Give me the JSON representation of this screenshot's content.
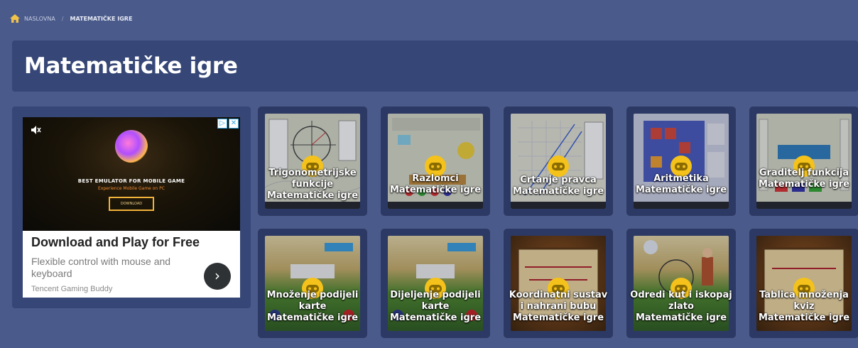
{
  "breadcrumb": {
    "home_icon": "home-icon",
    "home_label": "NASLOVNA",
    "separator": "/",
    "current_label": "MATEMATIČKE IGRE"
  },
  "page_title": "Matematičke igre",
  "ad": {
    "headline": "BEST EMULATOR FOR MOBILE GAME",
    "subheadline": "Experience Mobile Game on PC",
    "cta_small": "DOWNLOAD",
    "title": "Download and Play for Free",
    "description": "Flexible control with mouse and keyboard",
    "brand": "Tencent Gaming Buddy",
    "adchoices_label": "▷",
    "close_label": "✕",
    "arrow_label": "›"
  },
  "colors": {
    "page_bg": "#4a5a8a",
    "panel_bg": "#364676",
    "card_bg": "#2c3964",
    "badge": "#f4c21a"
  },
  "games": [
    {
      "title_lines": [
        "Trigonometrijske",
        "funkcije"
      ],
      "category": "Matematičke igre",
      "icon": "gamepad-icon"
    },
    {
      "title_lines": [
        "Razlomci"
      ],
      "category": "Matematičke igre",
      "icon": "gamepad-icon"
    },
    {
      "title_lines": [
        "Crtanje pravca"
      ],
      "category": "Matematičke igre",
      "icon": "gamepad-icon"
    },
    {
      "title_lines": [
        "Aritmetika"
      ],
      "category": "Matematičke igre",
      "icon": "gamepad-icon"
    },
    {
      "title_lines": [
        "Graditelj funkcija"
      ],
      "category": "Matematičke igre",
      "icon": "gamepad-icon"
    },
    {
      "title_lines": [
        "Množenje podijeli",
        "karte"
      ],
      "category": "Matematičke igre",
      "icon": "gamepad-icon"
    },
    {
      "title_lines": [
        "Dijeljenje podijeli",
        "karte"
      ],
      "category": "Matematičke igre",
      "icon": "gamepad-icon"
    },
    {
      "title_lines": [
        "Koordinatni sustav",
        "i nahrani bubu"
      ],
      "category": "Matematičke igre",
      "icon": "gamepad-icon"
    },
    {
      "title_lines": [
        "Odredi kut i iskopaj",
        "zlato"
      ],
      "category": "Matematičke igre",
      "icon": "gamepad-icon"
    },
    {
      "title_lines": [
        "Tablica množenja",
        "kviz"
      ],
      "category": "Matematičke igre",
      "icon": "gamepad-icon"
    }
  ]
}
